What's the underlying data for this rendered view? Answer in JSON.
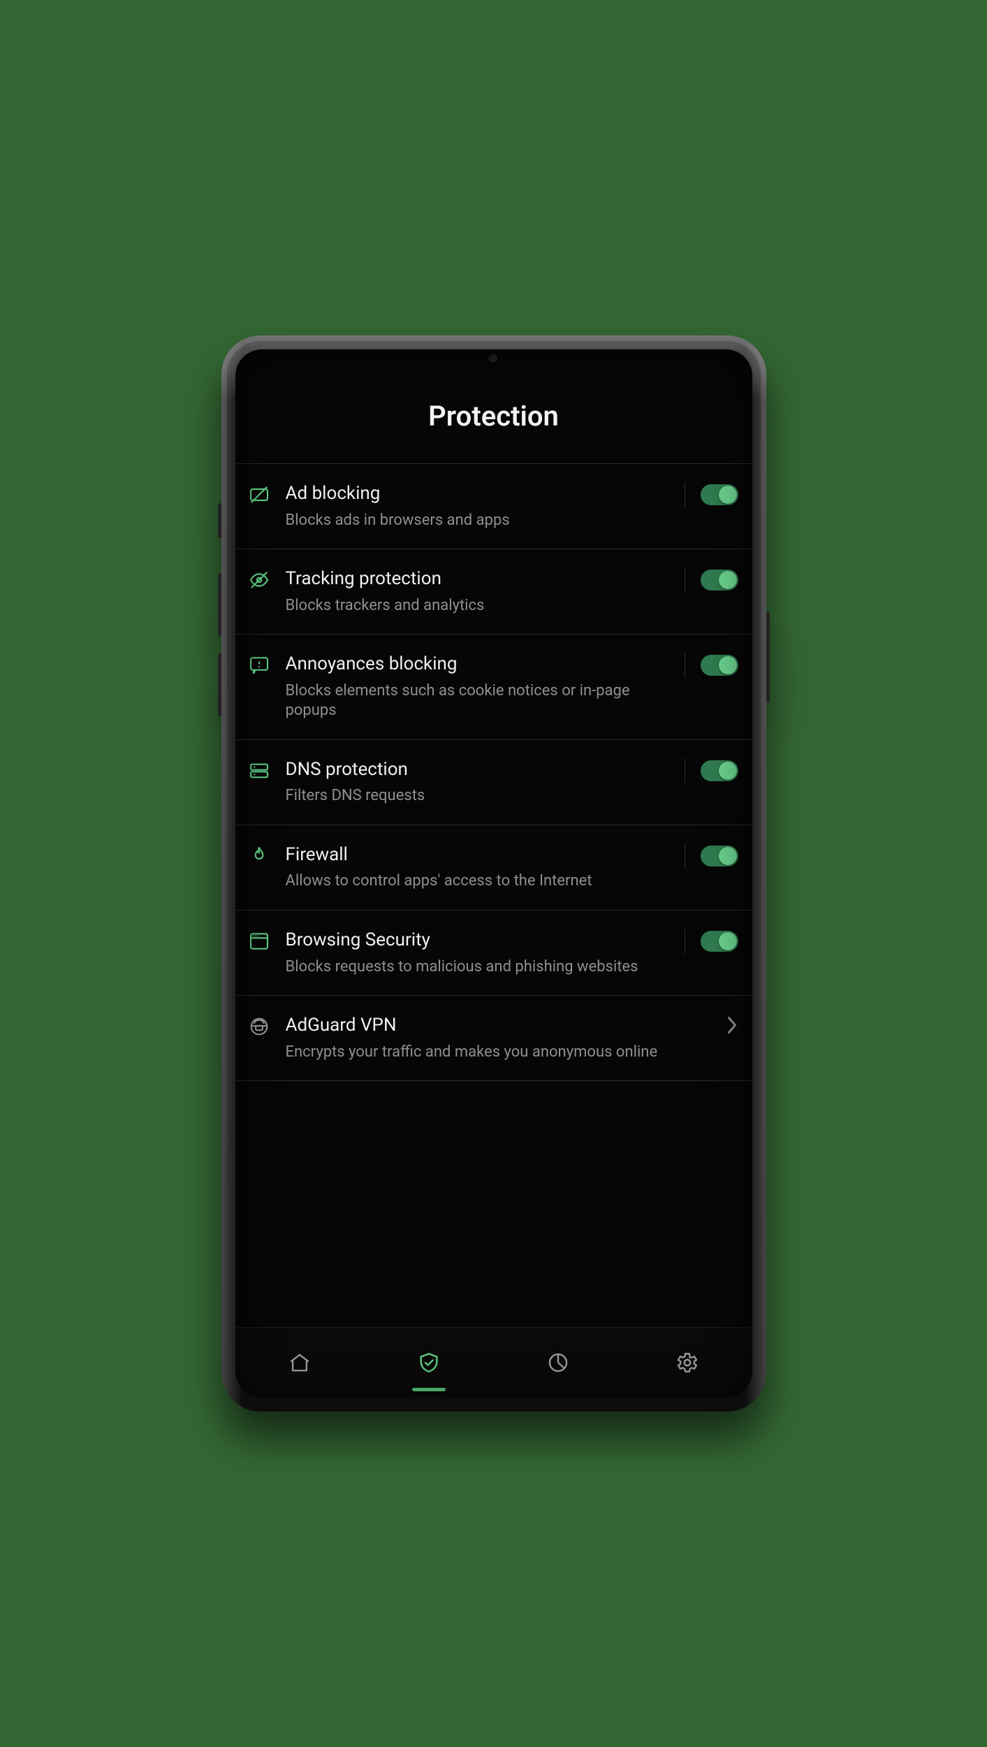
{
  "accent": "#5fcf85",
  "page_title": "Protection",
  "items": [
    {
      "icon": "ad-block",
      "title": "Ad blocking",
      "sub": "Blocks ads in browsers and apps",
      "right": "toggle",
      "on": true
    },
    {
      "icon": "eye-off",
      "title": "Tracking protection",
      "sub": "Blocks trackers and analytics",
      "right": "toggle",
      "on": true
    },
    {
      "icon": "annoyance",
      "title": "Annoyances blocking",
      "sub": "Blocks elements such as cookie notices or in-page popups",
      "right": "toggle",
      "on": true
    },
    {
      "icon": "dns",
      "title": "DNS protection",
      "sub": "Filters DNS requests",
      "right": "toggle",
      "on": true
    },
    {
      "icon": "firewall",
      "title": "Firewall",
      "sub": "Allows to control apps' access to the Internet",
      "right": "toggle",
      "on": true
    },
    {
      "icon": "browser",
      "title": "Browsing Security",
      "sub": "Blocks requests to malicious and phishing websites",
      "right": "toggle",
      "on": true
    },
    {
      "icon": "vpn",
      "title": "AdGuard VPN",
      "sub": "Encrypts your traffic and makes you anonymous online",
      "right": "chevron"
    }
  ],
  "nav": {
    "active_index": 1,
    "items": [
      "home",
      "protection",
      "stats",
      "settings"
    ]
  }
}
